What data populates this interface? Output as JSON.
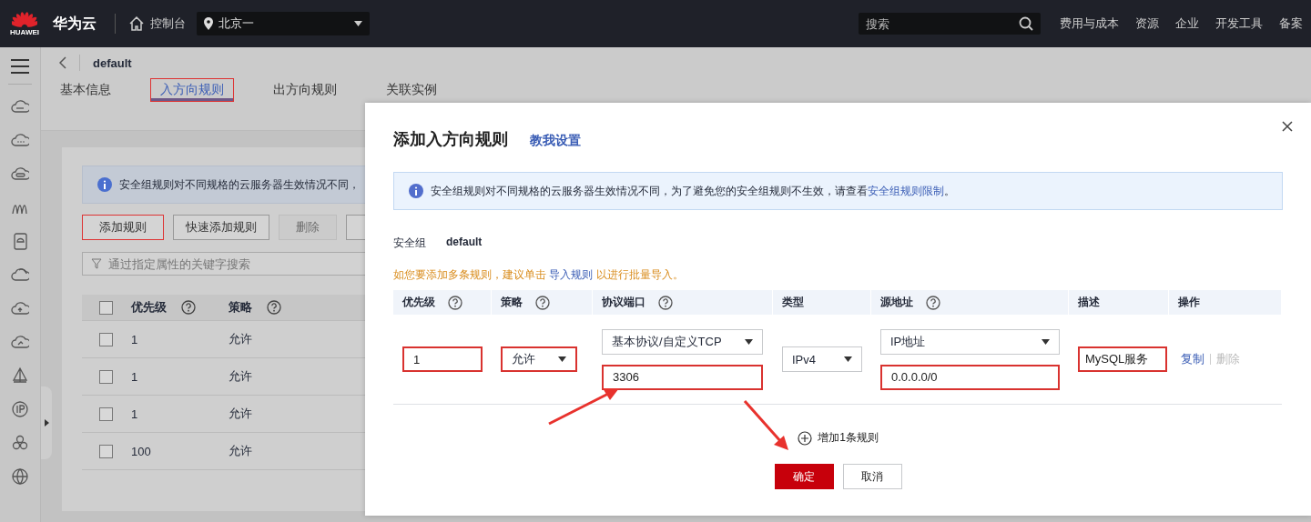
{
  "top_bar": {
    "logo_text": "HUAWEI",
    "brand": "华为云",
    "console": "控制台",
    "region": "北京一",
    "search": {
      "placeholder": "搜索"
    },
    "nav": [
      "费用与成本",
      "资源",
      "企业",
      "开发工具",
      "备案"
    ]
  },
  "page": {
    "title": "default",
    "tabs": [
      {
        "label": "基本信息",
        "selected": false,
        "highlighted": false
      },
      {
        "label": "入方向规则",
        "selected": true,
        "highlighted": true
      },
      {
        "label": "出方向规则",
        "selected": false,
        "highlighted": false
      },
      {
        "label": "关联实例",
        "selected": false,
        "highlighted": false
      }
    ],
    "notice": "安全组规则对不同规格的云服务器生效情况不同，",
    "buttons": [
      {
        "label": "添加规则",
        "disabled": false,
        "highlighted": true
      },
      {
        "label": "快速添加规则",
        "disabled": false,
        "highlighted": false
      },
      {
        "label": "删除",
        "disabled": true,
        "highlighted": false
      }
    ],
    "search": {
      "placeholder": "通过指定属性的关键字搜索"
    },
    "table": {
      "select_all": {
        "checked": false
      },
      "columns": [
        {
          "label": "优先级",
          "help": true
        },
        {
          "label": "策略",
          "help": true
        }
      ],
      "rows": [
        {
          "checked": false,
          "cells": [
            "1",
            "允许"
          ]
        },
        {
          "checked": false,
          "cells": [
            "1",
            "允许"
          ]
        },
        {
          "checked": false,
          "cells": [
            "1",
            "允许"
          ]
        },
        {
          "checked": false,
          "cells": [
            "100",
            "允许"
          ]
        }
      ]
    }
  },
  "dialog": {
    "title": "添加入方向规则",
    "help_link": "教我设置",
    "notice": {
      "text": "安全组规则对不同规格的云服务器生效情况不同，为了避免您的安全组规则不生效，请查看",
      "link": "安全组规则限制",
      "end": "。"
    },
    "group": {
      "label": "安全组",
      "value": "default"
    },
    "tip": {
      "before": "如您要添加多条规则，建议单击 ",
      "link": "导入规则",
      "after": " 以进行批量导入。"
    },
    "columns": [
      {
        "label": "优先级",
        "help": true
      },
      {
        "label": "策略",
        "help": true
      },
      {
        "label": "协议端口",
        "help": true
      },
      {
        "label": "类型",
        "help": false
      },
      {
        "label": "源地址",
        "help": true
      },
      {
        "label": "描述",
        "help": false
      },
      {
        "label": "操作",
        "help": false
      }
    ],
    "rule": {
      "priority": {
        "value": "1",
        "highlighted": true
      },
      "policy": {
        "value": "允许",
        "highlighted": true
      },
      "protocol": {
        "value": "基本协议/自定义TCP",
        "highlighted": false
      },
      "port": {
        "value": "3306",
        "highlighted": true
      },
      "type": {
        "value": "IPv4",
        "highlighted": false
      },
      "source_type": {
        "value": "IP地址",
        "highlighted": false
      },
      "source": {
        "value": "0.0.0.0/0",
        "highlighted": true
      },
      "description": {
        "value": "MySQL服务",
        "highlighted": true
      },
      "actions": [
        {
          "label": "复制",
          "disabled": false
        },
        {
          "label": "删除",
          "disabled": true
        }
      ]
    },
    "add_rule": "增加1条规则",
    "buttons": [
      {
        "label": "确定",
        "kind": "primary"
      },
      {
        "label": "取消",
        "kind": "secondary"
      }
    ]
  }
}
